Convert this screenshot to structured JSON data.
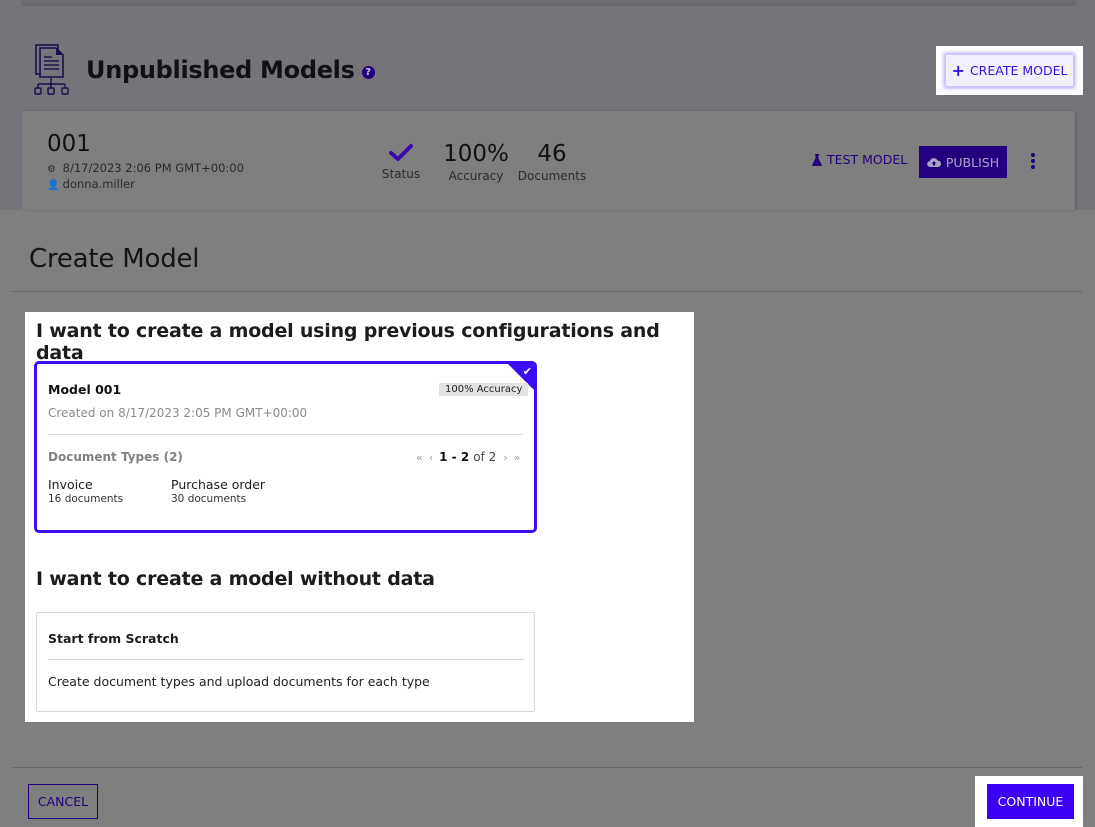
{
  "background_page": {
    "title": "Unpublished Models",
    "create_model_label": "CREATE MODEL",
    "model": {
      "id": "001",
      "trained_at": "8/17/2023 2:06 PM GMT+00:00",
      "user": "donna.miller",
      "status_label": "Status",
      "accuracy_value": "100%",
      "accuracy_label": "Accuracy",
      "documents_value": "46",
      "documents_label": "Documents",
      "test_label": "TEST MODEL",
      "publish_label": "PUBLISH"
    }
  },
  "dialog": {
    "title": "Create Model",
    "section_previous": {
      "heading": "I want to create a model using previous configurations and data",
      "card": {
        "title": "Model 001",
        "accuracy_badge": "100% Accuracy",
        "created": "Created on 8/17/2023 2:05 PM GMT+00:00",
        "doc_types_label": "Document Types (2)",
        "pager": {
          "first": "«",
          "prev": "‹",
          "range": "1 - 2",
          "of": "of 2",
          "next": "›",
          "last": "»"
        },
        "document_types": [
          {
            "name": "Invoice",
            "count": "16 documents"
          },
          {
            "name": "Purchase order",
            "count": "30 documents"
          }
        ],
        "selected": true
      }
    },
    "section_scratch": {
      "heading": "I want to create a model without data",
      "card": {
        "title": "Start from Scratch",
        "description": "Create document types and upload documents for each type"
      }
    },
    "cancel_label": "CANCEL",
    "continue_label": "CONTINUE"
  },
  "colors": {
    "accent": "#3b00f5",
    "accent_dark": "#22007e"
  }
}
